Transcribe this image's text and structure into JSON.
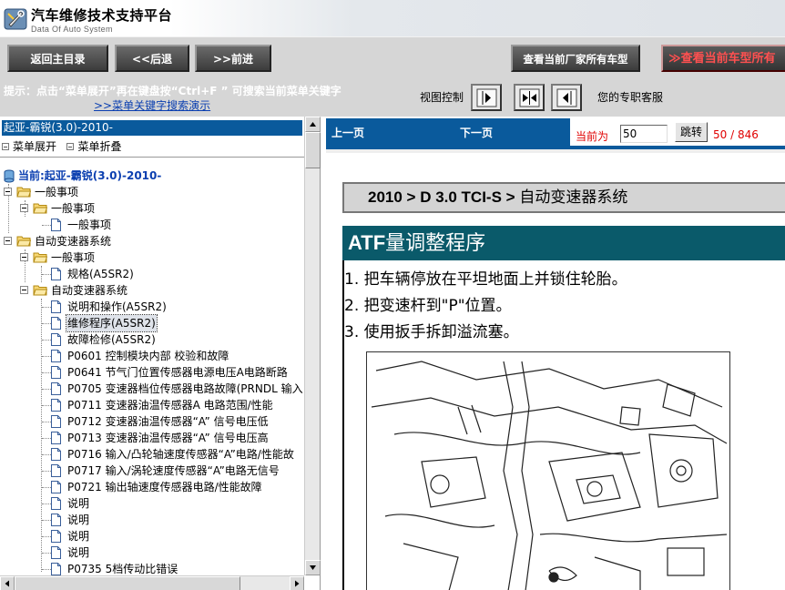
{
  "app": {
    "title": "汽车维修技术支持平台",
    "subtitle": "Data Of Auto System"
  },
  "nav": {
    "home": "返回主目录",
    "back": "<<后退",
    "forward": ">>前进",
    "all_models": "查看当前厂家所有车型",
    "current_model": "≫查看当前车型所有"
  },
  "hint": {
    "text": "提示：点击“菜单展开”再在键盘按“Ctrl+F ” 可搜索当前菜单关键字",
    "link": ">>菜单关键字搜索演示",
    "view_label": "视图控制",
    "service": "您的专职客服"
  },
  "tree": {
    "header": "起亚-霸锐(3.0)-2010-",
    "expand": "菜单展开",
    "collapse": "菜单折叠",
    "items": [
      {
        "label": "当前:起亚-霸锐(3.0)-2010-"
      },
      {
        "label": "一般事项"
      },
      {
        "label": "一般事项"
      },
      {
        "label": "一般事项"
      },
      {
        "label": "自动变速器系统"
      },
      {
        "label": "一般事项"
      },
      {
        "label": "规格(A5SR2)"
      },
      {
        "label": "自动变速器系统"
      },
      {
        "label": "说明和操作(A5SR2)"
      },
      {
        "label": "维修程序(A5SR2)"
      },
      {
        "label": "故障检修(A5SR2)"
      },
      {
        "label": "P0601 控制模块内部 校验和故障"
      },
      {
        "label": "P0641 节气门位置传感器电源电压A电路断路"
      },
      {
        "label": "P0705 变速器档位传感器电路故障(PRNDL 输入"
      },
      {
        "label": "P0711 变速器油温传感器A 电路范围/性能"
      },
      {
        "label": "P0712 变速器油温传感器“A” 信号电压低"
      },
      {
        "label": "P0713 变速器油温传感器“A” 信号电压高"
      },
      {
        "label": "P0716 输入/凸轮轴速度传感器“A”电路/性能故"
      },
      {
        "label": "P0717 输入/涡轮速度传感器“A”电路无信号"
      },
      {
        "label": "P0721 输出轴速度传感器电路/性能故障"
      },
      {
        "label": "说明"
      },
      {
        "label": "说明"
      },
      {
        "label": "说明"
      },
      {
        "label": "说明"
      },
      {
        "label": "P0735 5档传动比错误"
      }
    ]
  },
  "pager": {
    "prev": "上一页",
    "next": "下一页",
    "current_label": "当前为",
    "current_value": "50",
    "jump": "跳转",
    "count": "50 / 846"
  },
  "doc": {
    "breadcrumb_bold": "2010 > D 3.0 TCI-S >",
    "breadcrumb_rest": " 自动变速器系统",
    "section_en": "ATF",
    "section_cn": "量调整程序",
    "steps": [
      {
        "num": "1.",
        "text": "把车辆停放在平坦地面上并锁住轮胎。"
      },
      {
        "num": "2.",
        "text": "把变速杆到\"P\"位置。"
      },
      {
        "num": "3.",
        "text": "使用扳手拆卸溢流塞。"
      }
    ]
  },
  "colors": {
    "nav_bg": "#d6d6d6",
    "header_blue": "#0a5a9c",
    "section_teal": "#0a5a6a",
    "page_red": "#e00000",
    "link_blue": "#0b3fb0"
  }
}
